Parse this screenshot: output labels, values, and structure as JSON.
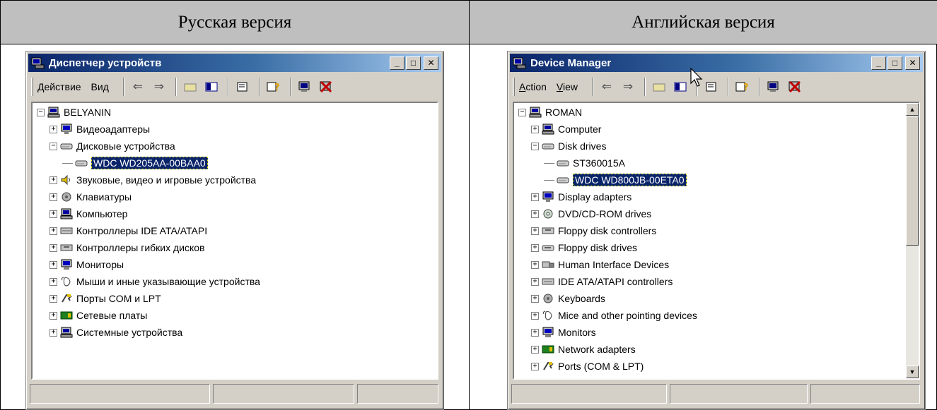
{
  "headers": {
    "left": "Русская версия",
    "right": "Английская версия"
  },
  "ru": {
    "title": "Диспетчер устройств",
    "menu": {
      "action": "Действие",
      "view": "Вид"
    },
    "tree": [
      {
        "label": "BELYANIN",
        "level": 0,
        "exp": "−",
        "icon": "computer-icon"
      },
      {
        "label": "Видеоадаптеры",
        "level": 1,
        "exp": "+",
        "icon": "display-adapter-icon"
      },
      {
        "label": "Дисковые устройства",
        "level": 1,
        "exp": "−",
        "icon": "disk-drive-icon"
      },
      {
        "label": "WDC WD205AA-00BAA0",
        "level": 2,
        "exp": "",
        "icon": "disk-drive-icon",
        "selected": true
      },
      {
        "label": "Звуковые, видео и игровые устройства",
        "level": 1,
        "exp": "+",
        "icon": "sound-icon"
      },
      {
        "label": "Клавиатуры",
        "level": 1,
        "exp": "+",
        "icon": "keyboard-icon"
      },
      {
        "label": "Компьютер",
        "level": 1,
        "exp": "+",
        "icon": "computer-icon"
      },
      {
        "label": "Контроллеры IDE ATA/ATAPI",
        "level": 1,
        "exp": "+",
        "icon": "ide-controller-icon"
      },
      {
        "label": "Контроллеры гибких дисков",
        "level": 1,
        "exp": "+",
        "icon": "floppy-controller-icon"
      },
      {
        "label": "Мониторы",
        "level": 1,
        "exp": "+",
        "icon": "monitor-icon"
      },
      {
        "label": "Мыши и иные указывающие устройства",
        "level": 1,
        "exp": "+",
        "icon": "mouse-icon"
      },
      {
        "label": "Порты COM и LPT",
        "level": 1,
        "exp": "+",
        "icon": "port-icon"
      },
      {
        "label": "Сетевые платы",
        "level": 1,
        "exp": "+",
        "icon": "network-adapter-icon"
      },
      {
        "label": "Системные устройства",
        "level": 1,
        "exp": "+",
        "icon": "system-device-icon"
      }
    ]
  },
  "en": {
    "title": "Device Manager",
    "menu": {
      "action_hotkey": "A",
      "action_rest": "ction",
      "view_hotkey": "V",
      "view_rest": "iew"
    },
    "tree": [
      {
        "label": "ROMAN",
        "level": 0,
        "exp": "−",
        "icon": "computer-icon"
      },
      {
        "label": "Computer",
        "level": 1,
        "exp": "+",
        "icon": "computer-icon"
      },
      {
        "label": "Disk drives",
        "level": 1,
        "exp": "−",
        "icon": "disk-drive-icon"
      },
      {
        "label": "ST360015A",
        "level": 2,
        "exp": "",
        "icon": "disk-drive-icon"
      },
      {
        "label": "WDC WD800JB-00ETA0",
        "level": 2,
        "exp": "",
        "icon": "disk-drive-icon",
        "selected": true
      },
      {
        "label": "Display adapters",
        "level": 1,
        "exp": "+",
        "icon": "display-adapter-icon"
      },
      {
        "label": "DVD/CD-ROM drives",
        "level": 1,
        "exp": "+",
        "icon": "cdrom-icon"
      },
      {
        "label": "Floppy disk controllers",
        "level": 1,
        "exp": "+",
        "icon": "floppy-controller-icon"
      },
      {
        "label": "Floppy disk drives",
        "level": 1,
        "exp": "+",
        "icon": "floppy-drive-icon"
      },
      {
        "label": "Human Interface Devices",
        "level": 1,
        "exp": "+",
        "icon": "hid-icon"
      },
      {
        "label": "IDE ATA/ATAPI controllers",
        "level": 1,
        "exp": "+",
        "icon": "ide-controller-icon"
      },
      {
        "label": "Keyboards",
        "level": 1,
        "exp": "+",
        "icon": "keyboard-icon"
      },
      {
        "label": "Mice and other pointing devices",
        "level": 1,
        "exp": "+",
        "icon": "mouse-icon"
      },
      {
        "label": "Monitors",
        "level": 1,
        "exp": "+",
        "icon": "monitor-icon"
      },
      {
        "label": "Network adapters",
        "level": 1,
        "exp": "+",
        "icon": "network-adapter-icon"
      },
      {
        "label": "Ports (COM & LPT)",
        "level": 1,
        "exp": "+",
        "icon": "port-icon"
      }
    ]
  },
  "colors": {
    "title_start": "#0a246a",
    "title_end": "#a6caf0",
    "selection": "#0a246a",
    "chrome": "#d4d0c8"
  }
}
